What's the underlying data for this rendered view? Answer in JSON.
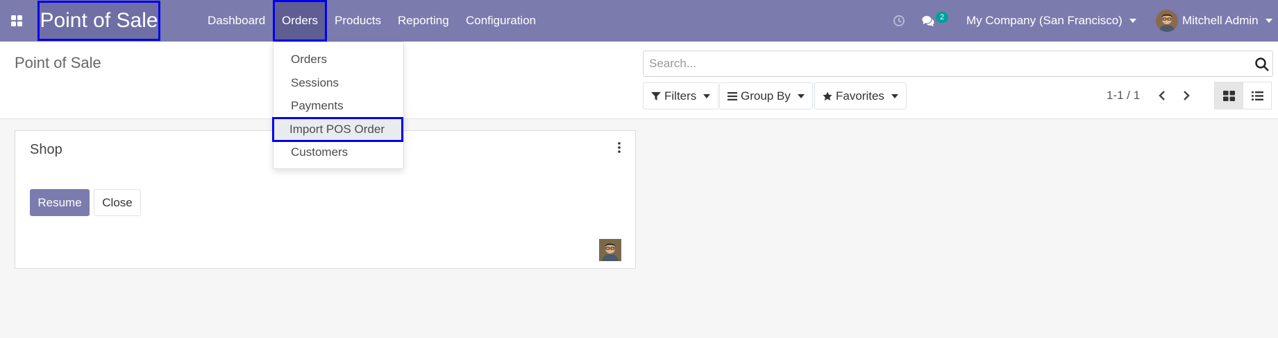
{
  "navbar": {
    "brand": "Point of Sale",
    "menu": [
      "Dashboard",
      "Orders",
      "Products",
      "Reporting",
      "Configuration"
    ],
    "chat_badge": "2",
    "company": "My Company (San Francisco)",
    "user": "Mitchell Admin"
  },
  "orders_dropdown": {
    "items": [
      "Orders",
      "Sessions",
      "Payments",
      "Import POS Order",
      "Customers"
    ],
    "highlighted": "Import POS Order"
  },
  "control_panel": {
    "title": "Point of Sale",
    "search_placeholder": "Search...",
    "filters_label": "Filters",
    "group_by_label": "Group By",
    "favorites_label": "Favorites",
    "pager": "1-1 / 1"
  },
  "card": {
    "title": "Shop",
    "resume_label": "Resume",
    "close_label": "Close"
  },
  "colors": {
    "primary": "#7c7bad",
    "highlight_outline": "#0000ee",
    "badge": "#00a09d"
  }
}
